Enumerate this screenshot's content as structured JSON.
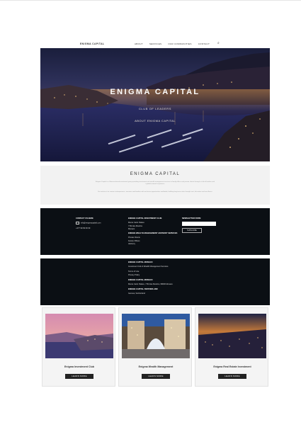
{
  "nav": {
    "logo": "ENIGMA CAPITAL",
    "items": [
      "ABOUT",
      "SERVICES",
      "OUR COMMUNITIES",
      "CONTACT"
    ],
    "search_icon": "search-icon"
  },
  "hero": {
    "title": "ENIGMA CAPITAL",
    "subtitle": "CLUB OF LEADERS",
    "cta": "ABOUT ENIGMA CAPITAL"
  },
  "intro": {
    "title": "ENIGMA CAPITAL",
    "para1": "Enigma Capital is a Monaco-based investment group providing investment and wealth management services to family offices and private clients through a club of leaders and a global network of partners.",
    "para2": "Our mission is to connect entrepreneurs, investors and families with exclusive opportunities worldwide, building long-term value through trust, discretion and excellence."
  },
  "footer_top": {
    "contact_heading": "CONTACT US HERE",
    "email": "info@enigmacapital.com",
    "phone_label": "+377 99 99 99 99",
    "company_heading": "ENIGMA CAPITAL INVESTMENT CLUB",
    "company_lines": [
      "Monte Carlo Palace",
      "7 Bd des Moulins",
      "Monaco"
    ],
    "wealth_heading": "ENIGMA WEALTH MANAGEMENT ADVISORY SERVICES",
    "wealth_lines": [
      "Private Clients",
      "Family Offices",
      "Advisory"
    ],
    "newsletter_heading": "NEWSLETTER FORM",
    "newsletter_button": "SUBSCRIBE"
  },
  "footer_bottom": {
    "block1_heading": "ENIGMA CAPITAL MONACO",
    "block1_lines": [
      "Investment Club & Wealth Management Services"
    ],
    "block2_lines": [
      "Terms of Use",
      "Privacy Policy"
    ],
    "block3_heading": "ENIGMA CAPITAL MONACO",
    "block3_lines": [
      "Monte Carlo Palace, 7 Bd des Moulins, 98000 Monaco"
    ],
    "block4_heading": "ENIGMA CAPITAL SWITZERLAND",
    "block4_lines": [
      "Geneva, Switzerland"
    ]
  },
  "cards": [
    {
      "title": "Enigma Investment Club",
      "button": "LEARN MORE"
    },
    {
      "title": "Enigma Wealth Management",
      "button": "LEARN MORE"
    },
    {
      "title": "Enigma Real Estate Investment",
      "button": "LEARN MORE"
    }
  ]
}
